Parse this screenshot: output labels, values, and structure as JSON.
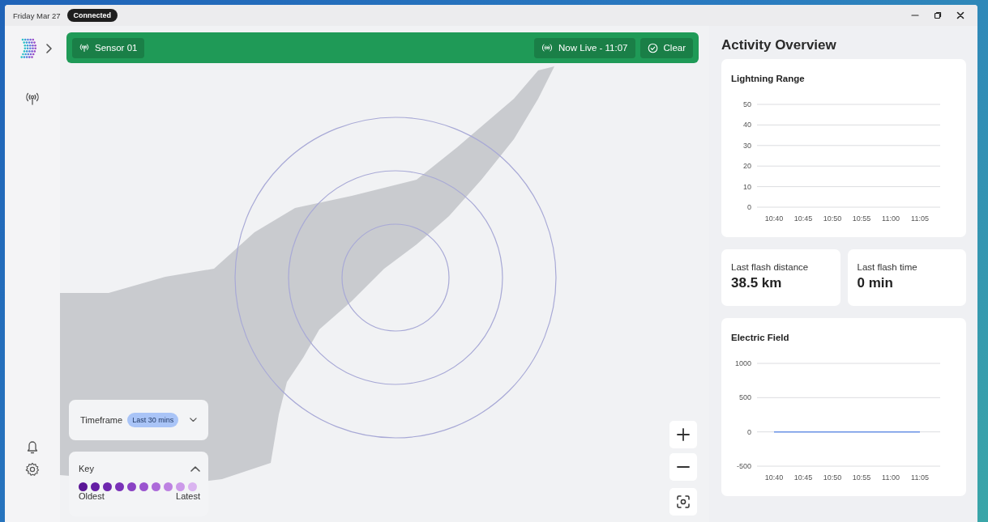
{
  "window": {
    "date": "Friday Mar 27",
    "status": "Connected"
  },
  "toolbar": {
    "sensor": "Sensor 01",
    "live": "Now Live - 11:07",
    "clear": "Clear"
  },
  "map": {
    "timeframe": {
      "label": "Timeframe",
      "value": "Last 30 mins",
      "expanded": false
    },
    "key": {
      "label": "Key",
      "expanded": true,
      "start": "Oldest",
      "end": "Latest",
      "dots": [
        {
          "color": "#5a1696"
        },
        {
          "color": "#641ea4"
        },
        {
          "color": "#6e27ae"
        },
        {
          "color": "#7a32b8"
        },
        {
          "color": "#8a42c4"
        },
        {
          "color": "#9a54cf"
        },
        {
          "color": "#ac6ad9"
        },
        {
          "color": "#bd82e2"
        },
        {
          "color": "#cc9ae9"
        },
        {
          "color": "#dab4f0"
        }
      ]
    }
  },
  "panel": {
    "title": "Activity Overview",
    "lightning": {
      "title": "Lightning Range",
      "chart_data": {
        "type": "line",
        "categories": [
          "10:40",
          "10:45",
          "10:50",
          "10:55",
          "11:00",
          "11:05"
        ],
        "ylim": [
          0,
          50
        ],
        "grid": true,
        "yticks": [
          0,
          10,
          20,
          30,
          40,
          50
        ]
      }
    },
    "stats": [
      {
        "label": "Last flash distance",
        "value": "38.5 km"
      },
      {
        "label": "Last flash time",
        "value": "0 min"
      }
    ],
    "electric": {
      "title": "Electric Field",
      "chart_data": {
        "type": "line",
        "categories": [
          "10:40",
          "10:45",
          "10:50",
          "10:55",
          "11:00",
          "11:05"
        ],
        "ylim": [
          -500,
          1000
        ],
        "grid": true,
        "yticks": [
          -500,
          0,
          500,
          1000
        ],
        "series": [
          {
            "color": "#6a92e6",
            "values": [
              0,
              0,
              0,
              0,
              0,
              0
            ]
          }
        ]
      }
    }
  }
}
